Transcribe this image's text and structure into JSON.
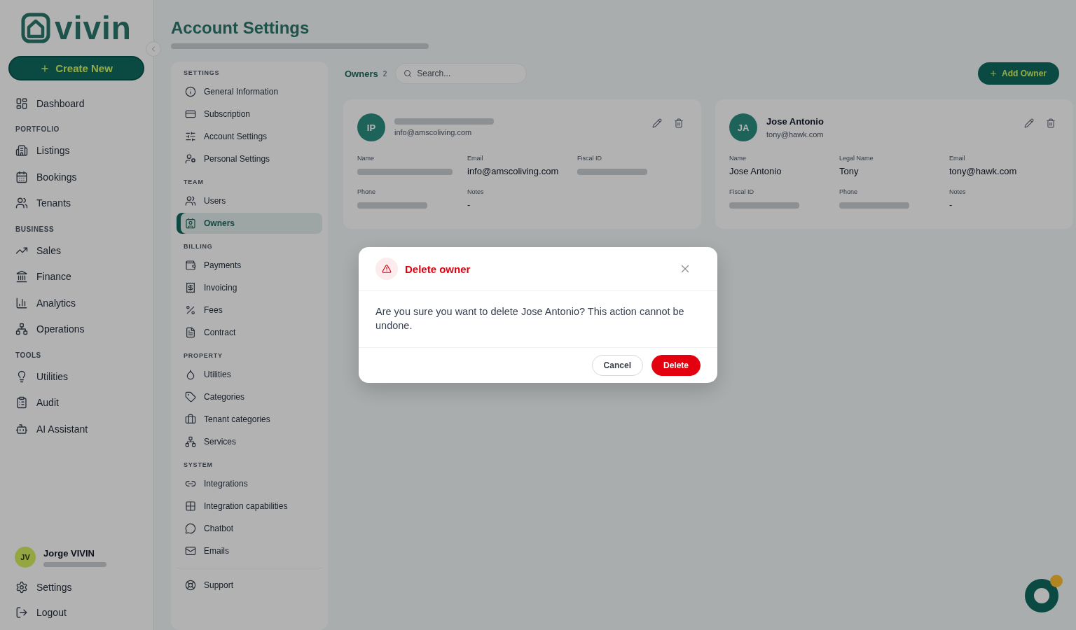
{
  "sidebar": {
    "logo_text": "vivin",
    "create_button": "Create New",
    "nav_sections": [
      {
        "items": [
          {
            "label": "Dashboard"
          }
        ]
      },
      {
        "heading": "PORTFOLIO",
        "items": [
          {
            "label": "Listings"
          },
          {
            "label": "Bookings"
          },
          {
            "label": "Tenants"
          }
        ]
      },
      {
        "heading": "BUSINESS",
        "items": [
          {
            "label": "Sales"
          },
          {
            "label": "Finance"
          },
          {
            "label": "Analytics"
          },
          {
            "label": "Operations"
          }
        ]
      },
      {
        "heading": "TOOLS",
        "items": [
          {
            "label": "Utilities"
          },
          {
            "label": "Audit"
          },
          {
            "label": "AI Assistant"
          }
        ]
      }
    ],
    "user": {
      "initials": "JV",
      "name": "Jorge VIVIN"
    },
    "footer_items": [
      {
        "label": "Settings"
      },
      {
        "label": "Logout"
      }
    ]
  },
  "page": {
    "title": "Account Settings"
  },
  "settings_nav": {
    "sections": [
      {
        "heading": "SETTINGS",
        "items": [
          {
            "label": "General Information",
            "selected": false
          },
          {
            "label": "Subscription",
            "selected": false
          },
          {
            "label": "Account Settings",
            "selected": false
          },
          {
            "label": "Personal Settings",
            "selected": false
          }
        ]
      },
      {
        "heading": "TEAM",
        "items": [
          {
            "label": "Users",
            "selected": false
          },
          {
            "label": "Owners",
            "selected": true
          }
        ]
      },
      {
        "heading": "BILLING",
        "items": [
          {
            "label": "Payments",
            "selected": false
          },
          {
            "label": "Invoicing",
            "selected": false
          },
          {
            "label": "Fees",
            "selected": false
          },
          {
            "label": "Contract",
            "selected": false
          }
        ]
      },
      {
        "heading": "PROPERTY",
        "items": [
          {
            "label": "Utilities",
            "selected": false
          },
          {
            "label": "Categories",
            "selected": false
          },
          {
            "label": "Tenant categories",
            "selected": false
          },
          {
            "label": "Services",
            "selected": false
          }
        ]
      },
      {
        "heading": "SYSTEM",
        "items": [
          {
            "label": "Integrations",
            "selected": false
          },
          {
            "label": "Integration capabilities",
            "selected": false
          },
          {
            "label": "Chatbot",
            "selected": false
          },
          {
            "label": "Emails",
            "selected": false
          }
        ]
      }
    ],
    "support": {
      "label": "Support",
      "selected": false
    }
  },
  "owners": {
    "title": "Owners",
    "count": "2",
    "search": {
      "placeholder": "Search..."
    },
    "add_button": "Add Owner",
    "cards": [
      {
        "initials": "IP",
        "email": "info@amscoliving.com",
        "fields": [
          {
            "label": "Name"
          },
          {
            "label": "Email",
            "value": "info@amscoliving.com"
          },
          {
            "label": "Fiscal ID"
          },
          {
            "label": "Phone"
          },
          {
            "label": "Notes",
            "value": "-"
          }
        ]
      },
      {
        "initials": "JA",
        "name": "Jose Antonio",
        "email": "tony@hawk.com",
        "fields": [
          {
            "label": "Name",
            "value": "Jose Antonio"
          },
          {
            "label": "Legal Name",
            "value": "Tony"
          },
          {
            "label": "Email",
            "value": "tony@hawk.com"
          },
          {
            "label": "Fiscal ID"
          },
          {
            "label": "Phone"
          },
          {
            "label": "Notes",
            "value": "-"
          }
        ]
      }
    ]
  },
  "dialog": {
    "title": "Delete owner",
    "message": "Are you sure you want to delete Jose Antonio? This action cannot be undone.",
    "buttons": [
      {
        "label": "Cancel",
        "kind": "secondary"
      },
      {
        "label": "Delete",
        "kind": "danger"
      }
    ]
  }
}
